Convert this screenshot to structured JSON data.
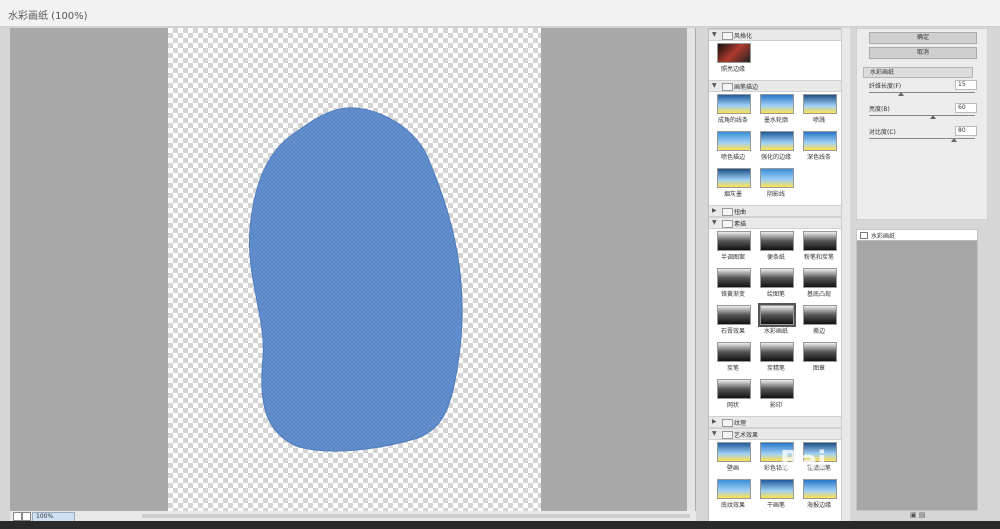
{
  "window": {
    "title": "水彩画纸 (100%)"
  },
  "statusbar": {
    "zoom": "100%"
  },
  "gallery": {
    "categories": [
      {
        "name": "风格化",
        "expanded": true,
        "filters": [
          "照亮边缘"
        ]
      },
      {
        "name": "画笔描边",
        "expanded": true,
        "filters": [
          "成角的线条",
          "墨水轮廓",
          "喷溅",
          "喷色描边",
          "强化的边缘",
          "深色线条",
          "烟灰墨",
          "阴影线"
        ]
      },
      {
        "name": "扭曲",
        "expanded": false
      },
      {
        "name": "素描",
        "expanded": true,
        "filters": [
          "半调图案",
          "便条纸",
          "粉笔和炭笔",
          "铬黄渐变",
          "绘图笔",
          "基底凸现",
          "石膏效果",
          "水彩画纸",
          "撕边",
          "炭笔",
          "炭精笔",
          "图章",
          "网状",
          "影印"
        ]
      },
      {
        "name": "纹理",
        "expanded": false
      },
      {
        "name": "艺术效果",
        "expanded": true,
        "filters": [
          "壁画",
          "彩色铅笔",
          "粗糙蜡笔",
          "底纹效果",
          "干画笔",
          "海报边缘"
        ]
      }
    ],
    "selected": "水彩画纸"
  },
  "controls": {
    "ok_label": "确定",
    "cancel_label": "取消",
    "filter_select": "水彩画纸",
    "sliders": [
      {
        "label": "纤维长度(F)",
        "value": "15",
        "fraction": 0.3
      },
      {
        "label": "亮度(B)",
        "value": "60",
        "fraction": 0.6
      },
      {
        "label": "对比度(C)",
        "value": "80",
        "fraction": 0.8
      }
    ]
  },
  "layers": {
    "items": [
      {
        "name": "水彩画纸"
      }
    ]
  },
  "watermark": "Bai"
}
